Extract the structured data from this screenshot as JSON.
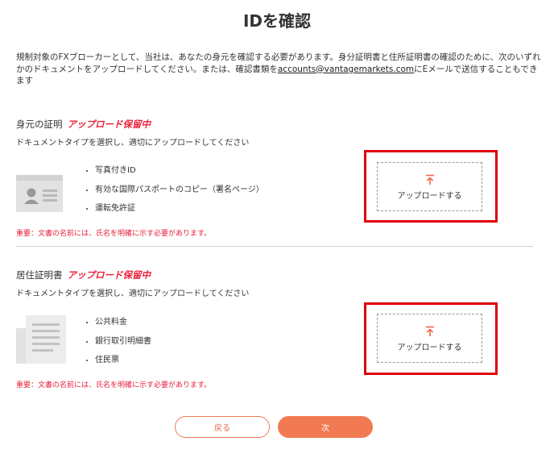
{
  "page": {
    "title": "IDを確認",
    "intro_text": "規制対象のFXブローカーとして、当社は、あなたの身元を確認する必要があります。身分証明書と住所証明書の確認のために、次のいずれかのドキュメントをアップロードしてください。または、確認書類を",
    "intro_email": "accounts@vantagemarkets.com",
    "intro_suffix": "にEメールで送信することもできます"
  },
  "identity": {
    "title": "身元の証明",
    "status": "アップロード保留中",
    "instruction": "ドキュメントタイプを選択し、適切にアップロードしてください",
    "items": [
      "写真付きID",
      "有効な国際パスポートのコピー（署名ページ）",
      "運転免許証"
    ],
    "upload_label": "アップロードする",
    "warning": "重要：文書の名前には、氏名を明確に示す必要があります。"
  },
  "address": {
    "title": "居住証明書",
    "status": "アップロード保留中",
    "instruction": "ドキュメントタイプを選択し、適切にアップロードしてください",
    "items": [
      "公共料金",
      "銀行取引明細書",
      "住民票"
    ],
    "upload_label": "アップロードする",
    "warning": "重要：文書の名前には、氏名を明確に示す必要があります。"
  },
  "buttons": {
    "back": "戻る",
    "next": "次"
  },
  "icons": {
    "identity_doc": "id-card-icon",
    "address_doc": "document-icon",
    "upload": "upload-arrow-icon"
  },
  "colors": {
    "accent": "#f27a52",
    "status": "#e8203a",
    "highlight_frame": "#e0000a",
    "illustration": "#e2e2e2"
  }
}
